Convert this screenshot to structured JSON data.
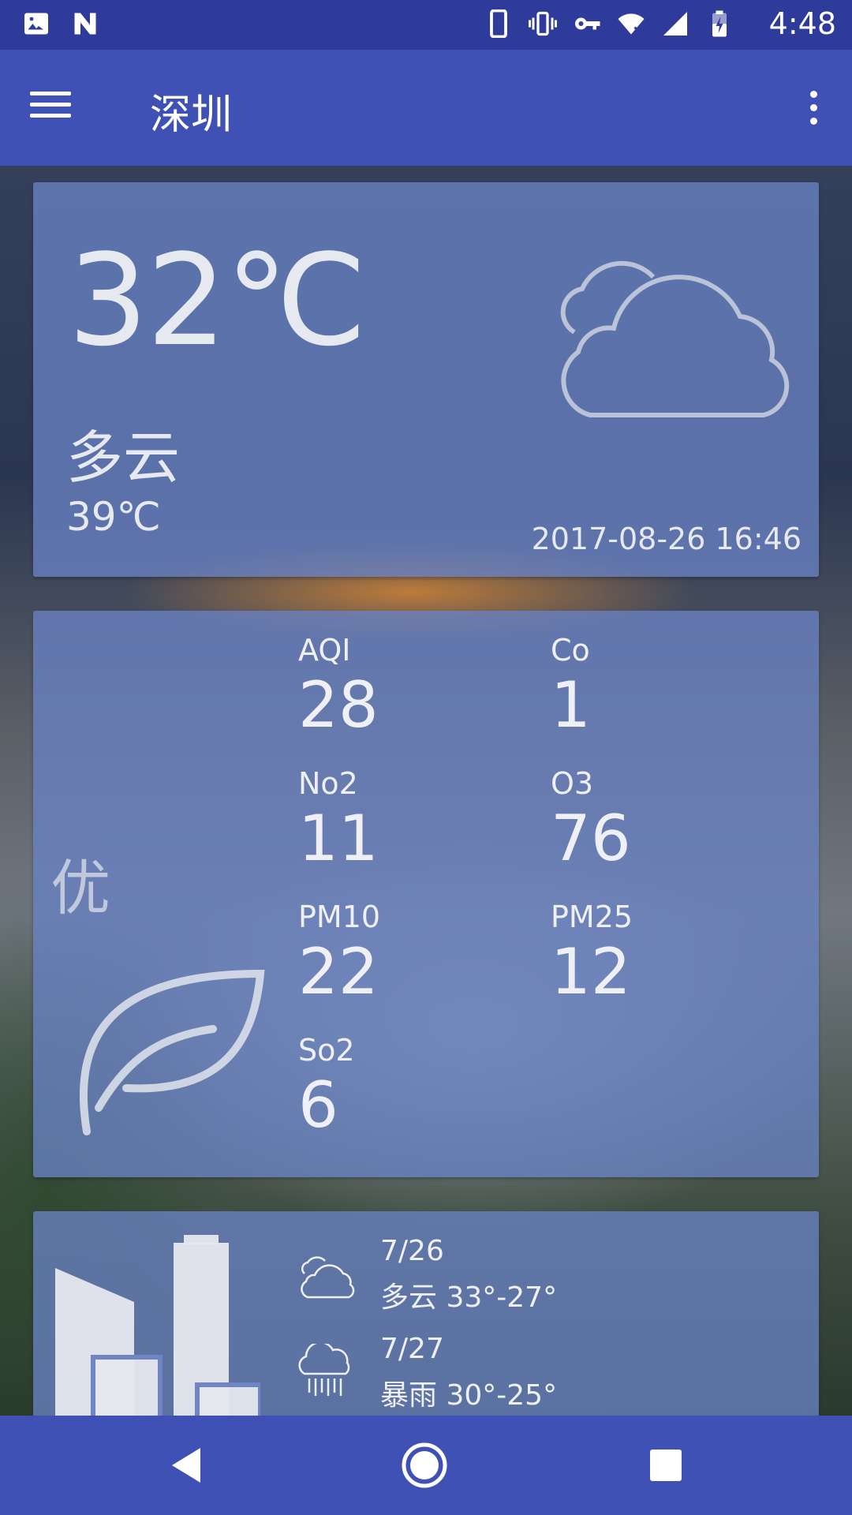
{
  "status_bar": {
    "time": "4:48",
    "left_icons": [
      "image-icon",
      "n-icon"
    ],
    "right_icons": [
      "phone-icon",
      "vibrate-icon",
      "vpn-key-icon",
      "wifi-icon",
      "signal-icon",
      "battery-charging-icon"
    ]
  },
  "toolbar": {
    "title": "深圳",
    "menu_icon": "hamburger-menu-icon",
    "more_icon": "more-vert-icon"
  },
  "now": {
    "temperature": "32℃",
    "condition": "多云",
    "feels_like": "39℃",
    "update_time": "2017-08-26 16:46",
    "icon": "cloudy-icon"
  },
  "air_quality": {
    "quality": "优",
    "icon": "leaf-icon",
    "items": [
      {
        "label": "AQI",
        "value": "28"
      },
      {
        "label": "Co",
        "value": "1"
      },
      {
        "label": "No2",
        "value": "11"
      },
      {
        "label": "O3",
        "value": "76"
      },
      {
        "label": "PM10",
        "value": "22"
      },
      {
        "label": "PM25",
        "value": "12"
      },
      {
        "label": "So2",
        "value": "6"
      }
    ]
  },
  "forecast": {
    "icon": "city-skyline-icon",
    "days": [
      {
        "date": "7/26",
        "condition": "多云",
        "range": "33°-27°",
        "icon": "cloudy-icon"
      },
      {
        "date": "7/27",
        "condition": "暴雨",
        "range": "30°-25°",
        "icon": "heavy-rain-icon"
      }
    ]
  },
  "nav_bar": {
    "back_icon": "back-triangle-icon",
    "home_icon": "home-circle-icon",
    "recents_icon": "recents-square-icon"
  },
  "colors": {
    "primary": "#3f51b5",
    "status_bar": "#2f3b9a",
    "card": "#6982c3"
  }
}
